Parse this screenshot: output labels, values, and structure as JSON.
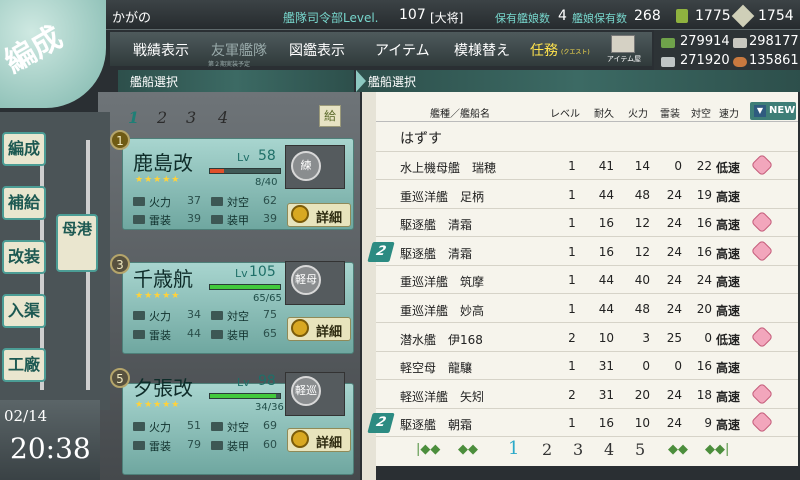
{
  "header": {
    "admiral_name": "かがの",
    "hq_level_label": "艦隊司令部Level.",
    "hq_level": "107",
    "rank": "[大将]",
    "ships_label": "保有艦娘数",
    "ships_count": "4",
    "equip_label": "艦娘保有数",
    "equip_count": "268",
    "buckets": "1775",
    "dev_materials": "1754"
  },
  "menu": {
    "items": [
      "戦績表示",
      "友軍艦隊",
      "図鑑表示",
      "アイテム",
      "模様替え",
      "任務"
    ],
    "friend_sub": "第２期実装予定",
    "quest_sub": "(クエスト)",
    "item_shop_label": "アイテム屋"
  },
  "resources": {
    "fuel": "279914",
    "ammo": "298177",
    "steel": "271920",
    "bauxite": "135861"
  },
  "panels": {
    "left_title": "艦船選択",
    "right_title": "艦船選択"
  },
  "fleet_tabs": [
    "1",
    "2",
    "3",
    "4"
  ],
  "supply_icon": "給",
  "nav": {
    "items": [
      "編成",
      "補給",
      "改装",
      "入渠",
      "工廠"
    ],
    "port": "母港",
    "badge": "編成"
  },
  "clock": {
    "date": "02/14",
    "time": "20:38"
  },
  "fleet_ships": [
    {
      "slot": "1",
      "name": "鹿島改",
      "lv_label": "Lv",
      "lv": "58",
      "hp": "8/40",
      "hp_ratio": 0.2,
      "hp_color": "#e0502a",
      "type_badge": "練",
      "stars": "★★★★★",
      "stats": [
        [
          "火力",
          "37"
        ],
        [
          "対空",
          "62"
        ],
        [
          "雷装",
          "39"
        ],
        [
          "装甲",
          "39"
        ]
      ],
      "detail": "詳細"
    },
    {
      "slot": "3",
      "name": "千歳航",
      "lv_label": "Lv",
      "lv": "105",
      "hp": "65/65",
      "hp_ratio": 1.0,
      "hp_color": "#42c93c",
      "type_badge": "軽母",
      "stars": "★★★★★",
      "stats": [
        [
          "火力",
          "34"
        ],
        [
          "対空",
          "75"
        ],
        [
          "雷装",
          "44"
        ],
        [
          "装甲",
          "65"
        ]
      ],
      "detail": "詳細"
    },
    {
      "slot": "5",
      "name": "夕張改",
      "lv_label": "Lv",
      "lv": "98",
      "hp": "34/36",
      "hp_ratio": 0.94,
      "hp_color": "#42c93c",
      "type_badge": "軽巡",
      "stars": "★★★★★",
      "stats": [
        [
          "火力",
          "51"
        ],
        [
          "対空",
          "69"
        ],
        [
          "雷装",
          "79"
        ],
        [
          "装甲",
          "60"
        ]
      ],
      "detail": "詳細"
    }
  ],
  "ship_list": {
    "headers": {
      "name": "艦種／艦船名",
      "lv": "レベル",
      "hp": "耐久",
      "fp": "火力",
      "torp": "雷装",
      "aa": "対空",
      "speed": "速力"
    },
    "sort_label": "NEW",
    "sort_arrow": "▼",
    "remove": "はずす",
    "rows": [
      {
        "type": "水上機母艦",
        "name": "瑞穂",
        "lv": "1",
        "hp": "41",
        "fp": "14",
        "torp": "0",
        "aa": "22",
        "speed": "低速",
        "heart": true,
        "fleet": ""
      },
      {
        "type": "重巡洋艦",
        "name": "足柄",
        "lv": "1",
        "hp": "44",
        "fp": "48",
        "torp": "24",
        "aa": "19",
        "speed": "高速",
        "heart": false,
        "fleet": ""
      },
      {
        "type": "駆逐艦",
        "name": "清霜",
        "lv": "1",
        "hp": "16",
        "fp": "12",
        "torp": "24",
        "aa": "16",
        "speed": "高速",
        "heart": true,
        "fleet": ""
      },
      {
        "type": "駆逐艦",
        "name": "清霜",
        "lv": "1",
        "hp": "16",
        "fp": "12",
        "torp": "24",
        "aa": "16",
        "speed": "高速",
        "heart": true,
        "fleet": "2"
      },
      {
        "type": "重巡洋艦",
        "name": "筑摩",
        "lv": "1",
        "hp": "44",
        "fp": "40",
        "torp": "24",
        "aa": "24",
        "speed": "高速",
        "heart": false,
        "fleet": ""
      },
      {
        "type": "重巡洋艦",
        "name": "妙高",
        "lv": "1",
        "hp": "44",
        "fp": "48",
        "torp": "24",
        "aa": "20",
        "speed": "高速",
        "heart": false,
        "fleet": ""
      },
      {
        "type": "潜水艦",
        "name": "伊168",
        "lv": "2",
        "hp": "10",
        "fp": "3",
        "torp": "25",
        "aa": "0",
        "speed": "低速",
        "heart": true,
        "fleet": ""
      },
      {
        "type": "軽空母",
        "name": "龍驤",
        "lv": "1",
        "hp": "31",
        "fp": "0",
        "torp": "0",
        "aa": "16",
        "speed": "高速",
        "heart": false,
        "fleet": ""
      },
      {
        "type": "軽巡洋艦",
        "name": "矢矧",
        "lv": "2",
        "hp": "31",
        "fp": "20",
        "torp": "24",
        "aa": "18",
        "speed": "高速",
        "heart": true,
        "fleet": ""
      },
      {
        "type": "駆逐艦",
        "name": "朝霜",
        "lv": "1",
        "hp": "16",
        "fp": "10",
        "torp": "24",
        "aa": "9",
        "speed": "高速",
        "heart": true,
        "fleet": "2"
      }
    ],
    "pager": {
      "first": "|◆◆",
      "prev": "◆◆",
      "pages": [
        "1",
        "2",
        "3",
        "4",
        "5"
      ],
      "next": "◆◆",
      "last": "◆◆|"
    }
  },
  "colors": {
    "accent": "#3e7e77",
    "quest": "#ffe34d",
    "current_page": "#2ba9c9"
  }
}
